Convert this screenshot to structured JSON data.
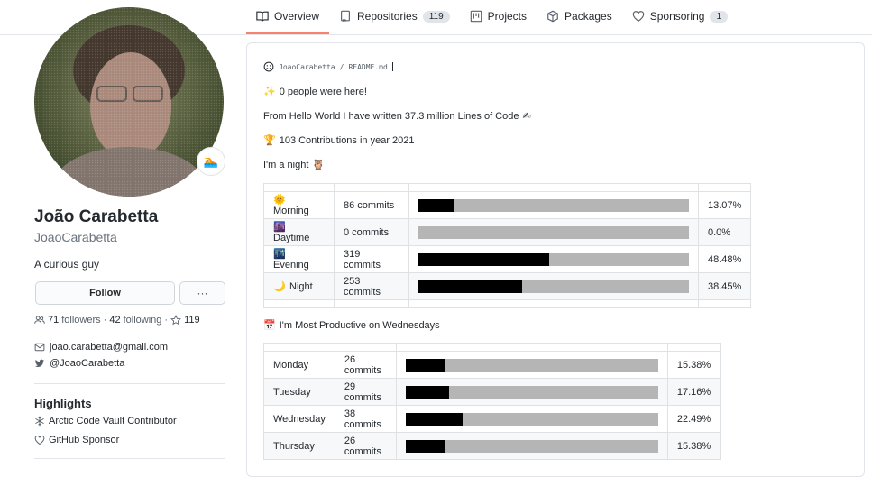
{
  "nav": {
    "tabs": [
      {
        "label": "Overview",
        "icon": "book-icon",
        "selected": true
      },
      {
        "label": "Repositories",
        "icon": "repo-icon",
        "count": "119"
      },
      {
        "label": "Projects",
        "icon": "project-icon"
      },
      {
        "label": "Packages",
        "icon": "package-icon"
      },
      {
        "label": "Sponsoring",
        "icon": "heart-icon",
        "count": "1"
      }
    ]
  },
  "profile": {
    "full_name": "João Carabetta",
    "username": "JoaoCarabetta",
    "bio": "A curious guy",
    "status_emoji": "🏊",
    "follow_label": "Follow",
    "more_label": "···",
    "followers_count": "71",
    "followers_label": "followers",
    "following_count": "42",
    "following_label": "following",
    "stars_count": "119",
    "email": "joao.carabetta@gmail.com",
    "twitter": "@JoaoCarabetta",
    "highlights_title": "Highlights",
    "highlights": [
      "Arctic Code Vault Contributor",
      "GitHub Sponsor"
    ]
  },
  "readme": {
    "path_user": "JoaoCarabetta",
    "path_sep": "/",
    "path_file": "README.md",
    "visitors": "0 people were here!",
    "lines_written": "From Hello World I have written 37.3 million Lines of Code",
    "contributions": "103 Contributions in year 2021",
    "night_owl": "I'm a night",
    "productive_day": "I'm Most Productive on Wednesdays",
    "time_of_day": [
      {
        "emoji": "🌞",
        "label": "Morning",
        "commits": "86 commits",
        "percent": "13.07%",
        "value": 13.07
      },
      {
        "emoji": "🌆",
        "label": "Daytime",
        "commits": "0 commits",
        "percent": "0.0%",
        "value": 0.0
      },
      {
        "emoji": "🌃",
        "label": "Evening",
        "commits": "319 commits",
        "percent": "48.48%",
        "value": 48.48
      },
      {
        "emoji": "🌙",
        "label": "Night",
        "commits": "253 commits",
        "percent": "38.45%",
        "value": 38.45
      }
    ],
    "days": [
      {
        "label": "Monday",
        "commits": "26 commits",
        "percent": "15.38%",
        "value": 15.38
      },
      {
        "label": "Tuesday",
        "commits": "29 commits",
        "percent": "17.16%",
        "value": 17.16
      },
      {
        "label": "Wednesday",
        "commits": "38 commits",
        "percent": "22.49%",
        "value": 22.49
      },
      {
        "label": "Thursday",
        "commits": "26 commits",
        "percent": "15.38%",
        "value": 15.38
      }
    ]
  },
  "colors": {
    "accent": "#f9826c",
    "bar_bg": "#b5b5b5",
    "bar_fill": "#000000"
  }
}
